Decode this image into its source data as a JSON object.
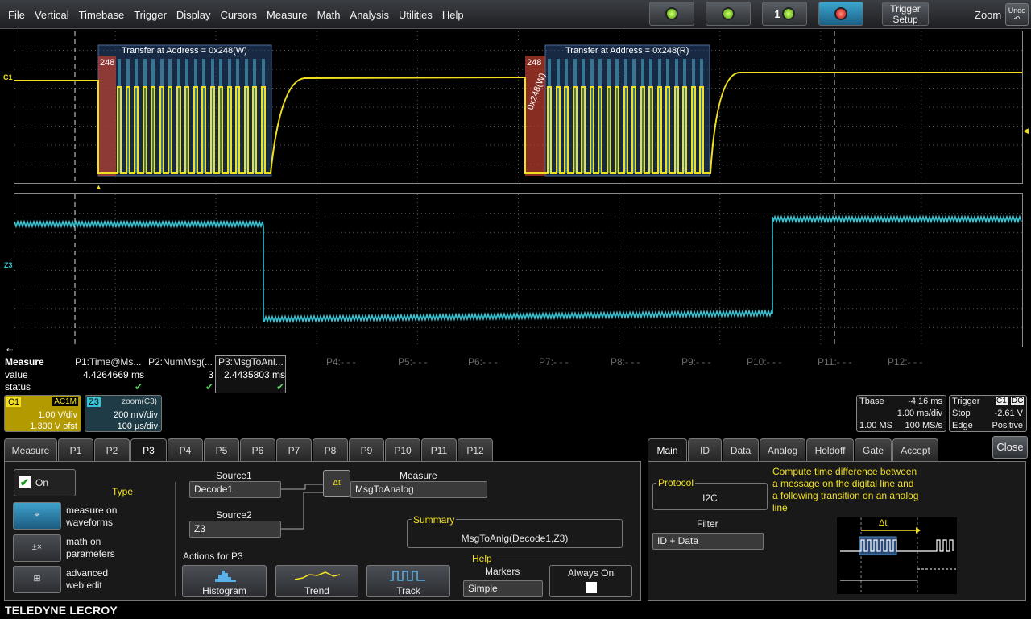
{
  "menu": [
    "File",
    "Vertical",
    "Timebase",
    "Trigger",
    "Display",
    "Cursors",
    "Measure",
    "Math",
    "Analysis",
    "Utilities",
    "Help"
  ],
  "toolbar": {
    "trigger_setup": [
      "Trigger",
      "Setup"
    ],
    "zoom": "Zoom",
    "undo": "Undo",
    "auto_digit": "1"
  },
  "c1_trace": {
    "label": "C1",
    "color": "#f0e020",
    "annotations": [
      {
        "title": "Transfer at Address = 0x248(W)",
        "addr": "248"
      },
      {
        "title": "Transfer at Address = 0x248(R)",
        "addr": "248"
      }
    ],
    "rotated_label": "0x248(W)"
  },
  "z3_trace": {
    "label": "Z3",
    "color": "#35c6d6"
  },
  "measure_table": {
    "title": "Measure",
    "rows": [
      "value",
      "status"
    ],
    "params": [
      {
        "name": "P1:Time@Ms...",
        "value": "4.4264669 ms",
        "status": "✔"
      },
      {
        "name": "P2:NumMsg(...",
        "value": "3",
        "status": "✔"
      },
      {
        "name": "P3:MsgToAnl...",
        "value": "2.4435803 ms",
        "status": "✔"
      },
      {
        "name": "P4:- - -"
      },
      {
        "name": "P5:- - -"
      },
      {
        "name": "P6:- - -"
      },
      {
        "name": "P7:- - -"
      },
      {
        "name": "P8:- - -"
      },
      {
        "name": "P9:- - -"
      },
      {
        "name": "P10:- - -"
      },
      {
        "name": "P11:- - -"
      },
      {
        "name": "P12:- - -"
      }
    ]
  },
  "descriptors": {
    "c1": {
      "tag": "C1",
      "coupling": "AC1M",
      "vdiv": "1.00 V/div",
      "offset": "1.300 V ofst"
    },
    "z3": {
      "tag": "Z3",
      "source": "zoom(C3)",
      "vdiv": "200 mV/div",
      "tdiv": "100 µs/div"
    }
  },
  "timebase": {
    "title": "Tbase",
    "delay": "-4.16 ms",
    "tdiv": "1.00 ms/div",
    "samples": "1.00 MS",
    "rate": "100 MS/s"
  },
  "trigger": {
    "title": "Trigger",
    "ch": "C1",
    "coupling": "DC",
    "mode": "Stop",
    "level": "-2.61 V",
    "type": "Edge",
    "slope": "Positive"
  },
  "tabs_left": [
    "Measure",
    "P1",
    "P2",
    "P3",
    "P4",
    "P5",
    "P6",
    "P7",
    "P8",
    "P9",
    "P10",
    "P11",
    "P12"
  ],
  "tabs_right": [
    "Main",
    "ID",
    "Data",
    "Analog",
    "Holdoff",
    "Gate",
    "Accept"
  ],
  "p3_panel": {
    "on_label": "On",
    "type_label": "Type",
    "types": [
      {
        "icon": "measure-waveform-icon",
        "text": [
          "measure on",
          "waveforms"
        ]
      },
      {
        "icon": "math-on-parameters-icon",
        "text": [
          "math on",
          "parameters"
        ]
      },
      {
        "icon": "web-edit-icon",
        "text": [
          "advanced",
          "web edit"
        ]
      }
    ],
    "source1_label": "Source1",
    "source1": "Decode1",
    "source2_label": "Source2",
    "source2": "Z3",
    "measure_label": "Measure",
    "measure": "MsgToAnalog",
    "summary_label": "Summary",
    "summary": "MsgToAnlg(Decode1,Z3)",
    "actions_label": "Actions for P3",
    "actions": [
      "Histogram",
      "Trend",
      "Track"
    ],
    "help_label": "Help",
    "markers_label": "Markers",
    "markers": "Simple",
    "always_on_label": "Always On"
  },
  "main_panel": {
    "protocol_label": "Protocol",
    "protocol": "I2C",
    "filter_label": "Filter",
    "filter": "ID + Data",
    "description": [
      "Compute time difference between",
      "a message on the digital line and",
      "a following transition on an analog",
      "line"
    ],
    "delta_label": "Δt"
  },
  "close": "Close",
  "brand": "TELEDYNE LECROY"
}
